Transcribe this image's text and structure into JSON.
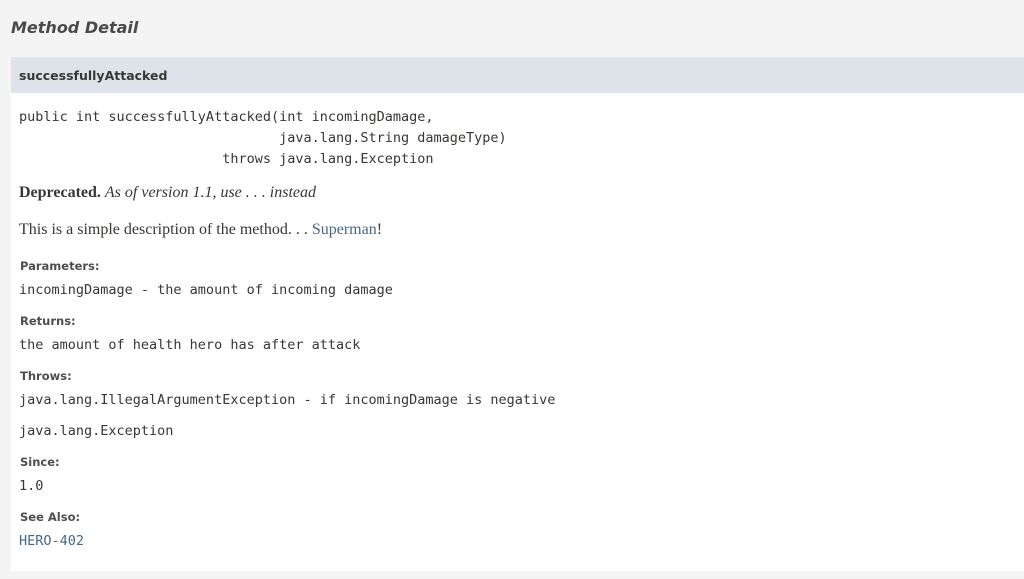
{
  "section_title": "Method Detail",
  "method": {
    "name": "successfullyAttacked",
    "signature": {
      "line1": "public int successfullyAttacked(int incomingDamage,",
      "line2": "                                java.lang.String damageType)",
      "line3": "                         throws java.lang.Exception"
    },
    "deprecated_label": "Deprecated.",
    "deprecated_note": "As of version 1.1, use . . . instead",
    "description_text": "This is a simple description of the method. . . ",
    "description_link": "Superman",
    "description_suffix": "!"
  },
  "parameters": {
    "label": "Parameters:",
    "value": "incomingDamage - the amount of incoming damage"
  },
  "returns": {
    "label": "Returns:",
    "value": "the amount of health hero has after attack"
  },
  "throws": {
    "label": "Throws:",
    "items": [
      "java.lang.IllegalArgumentException - if incomingDamage is negative",
      "java.lang.Exception"
    ]
  },
  "since": {
    "label": "Since:",
    "value": "1.0"
  },
  "see_also": {
    "label": "See Also:",
    "link": "HERO-402"
  },
  "colors": {
    "header_bg": "#dee3e9",
    "link": "#4a6782",
    "text": "#353833"
  }
}
